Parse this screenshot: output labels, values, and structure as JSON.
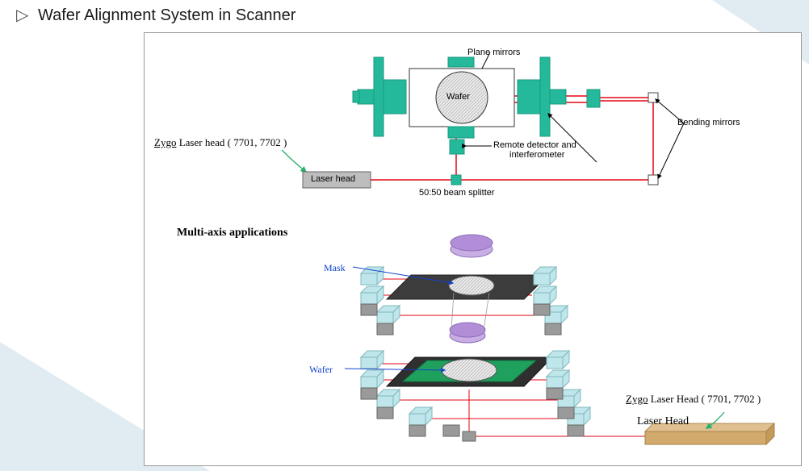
{
  "title": "Wafer Alignment System in Scanner",
  "top_diagram": {
    "zygo_label": {
      "prefix": "Zygo",
      "rest": " Laser head ( 7701, 7702 )"
    },
    "laser_head_box": "Laser head",
    "beam_splitter": "50:50 beam splitter",
    "remote_detector_line1": "Remote detector and",
    "remote_detector_line2": "interferometer",
    "plane_mirrors": "Plane mirrors",
    "bending_mirrors": "Bending mirrors",
    "wafer": "Wafer"
  },
  "bottom_diagram": {
    "section_title": "Multi-axis applications",
    "mask_label": "Mask",
    "wafer_label": "Wafer",
    "zygo_label": {
      "prefix": "Zygo",
      "rest": " Laser Head ( 7701, 7702 )"
    },
    "laser_head_label": "Laser Head"
  },
  "colors": {
    "teal": "#24b99a",
    "teal_dark": "#1a9980",
    "red": "#e30613",
    "blue": "#1144cc",
    "violet": "#b38ed8",
    "gray": "#bdbdbd",
    "darkgray": "#4a4a4a",
    "tan": "#d2aa6d"
  }
}
